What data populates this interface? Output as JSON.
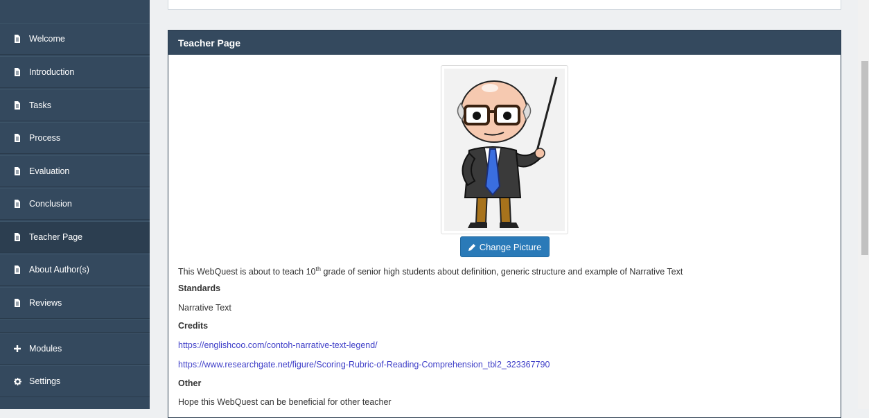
{
  "sidebar": {
    "items": [
      {
        "label": "Welcome",
        "icon": "file-icon"
      },
      {
        "label": "Introduction",
        "icon": "file-icon"
      },
      {
        "label": "Tasks",
        "icon": "file-icon"
      },
      {
        "label": "Process",
        "icon": "file-icon"
      },
      {
        "label": "Evaluation",
        "icon": "file-icon"
      },
      {
        "label": "Conclusion",
        "icon": "file-icon"
      },
      {
        "label": "Teacher Page",
        "icon": "file-icon",
        "active": true
      },
      {
        "label": "About Author(s)",
        "icon": "file-icon"
      },
      {
        "label": "Reviews",
        "icon": "file-icon"
      }
    ],
    "modules_label": "Modules",
    "settings_label": "Settings"
  },
  "panel": {
    "title": "Teacher Page",
    "change_picture_label": "Change Picture",
    "description_pre": "This WebQuest is about to teach 10",
    "description_sup": "th",
    "description_post": " grade of senior high students about definition, generic structure and example of Narrative Text",
    "standards_heading": "Standards",
    "standards_text": "Narrative Text",
    "credits_heading": "Credits",
    "credits_links": [
      "https://englishcoo.com/contoh-narrative-text-legend/",
      "https://www.researchgate.net/figure/Scoring-Rubric-of-Reading-Comprehension_tbl2_323367790"
    ],
    "other_heading": "Other",
    "other_text": "Hope this WebQuest can be beneficial for other teacher"
  },
  "colors": {
    "sidebar_bg": "#34495e",
    "panel_header_bg": "#34495e",
    "button_bg": "#2a7ab8",
    "link": "#3f3fc8"
  }
}
